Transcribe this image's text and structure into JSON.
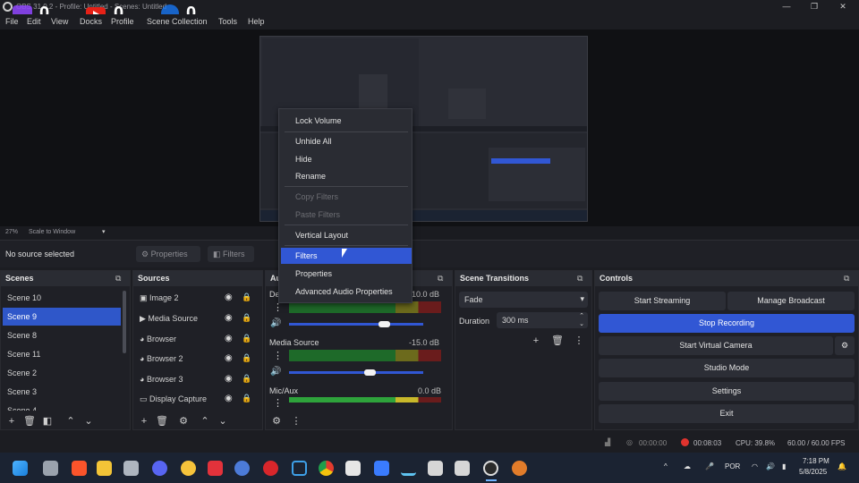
{
  "window": {
    "title": "OBS 31.0.2 - Profile: Untitled - Scenes: Untitled"
  },
  "overlay": {
    "twitch_count": "0",
    "youtube_count": "0",
    "facebook_count": "0"
  },
  "menu": [
    "File",
    "Edit",
    "View",
    "Docks",
    "Profile",
    "Scene Collection",
    "Tools",
    "Help"
  ],
  "preview": {
    "zoom": "27%",
    "scale_mode": "Scale to Window"
  },
  "source_bar": {
    "status": "No source selected",
    "properties_label": "Properties",
    "filters_label": "Filters"
  },
  "context_menu": {
    "items": [
      "Lock Volume",
      "Unhide All",
      "Hide",
      "Rename",
      "Copy Filters",
      "Paste Filters",
      "Vertical Layout",
      "Filters",
      "Properties",
      "Advanced Audio Properties"
    ],
    "highlighted": "Filters",
    "disabled": [
      "Copy Filters",
      "Paste Filters"
    ]
  },
  "scenes": {
    "title": "Scenes",
    "items": [
      "Scene 10",
      "Scene 9",
      "Scene 8",
      "Scene 11",
      "Scene 2",
      "Scene 3",
      "Scene 4"
    ],
    "selected": "Scene 9"
  },
  "sources": {
    "title": "Sources",
    "items": [
      "Image 2",
      "Media Source",
      "Browser",
      "Browser 2",
      "Browser 3",
      "Display Capture"
    ]
  },
  "mixer": {
    "title": "Audio Mixer",
    "channels": [
      {
        "name": "Desktop Audio",
        "db": "-10.0 dB",
        "level": 0.72
      },
      {
        "name": "Media Source",
        "db": "-15.0 dB",
        "level": 0.53
      },
      {
        "name": "Mic/Aux",
        "db": "0.0 dB",
        "level": 0.0
      }
    ],
    "scale": [
      "-60",
      "-55",
      "-50",
      "-45",
      "-40",
      "-35",
      "-30",
      "-25",
      "-20",
      "-15",
      "-10",
      "-5",
      "0"
    ]
  },
  "transitions": {
    "title": "Scene Transitions",
    "type": "Fade",
    "duration_label": "Duration",
    "duration": "300 ms"
  },
  "controls": {
    "title": "Controls",
    "start_streaming": "Start Streaming",
    "manage_broadcast": "Manage Broadcast",
    "stop_recording": "Stop Recording",
    "start_virtual_camera": "Start Virtual Camera",
    "studio_mode": "Studio Mode",
    "settings": "Settings",
    "exit": "Exit"
  },
  "status": {
    "stream_time": "00:00:00",
    "rec_time": "00:08:03",
    "cpu": "CPU: 39.8%",
    "fps": "60.00 / 60.00 FPS"
  },
  "taskbar": {
    "lang": "POR",
    "time": "7:18 PM",
    "date": "5/8/2025"
  },
  "colors": {
    "accent": "#3157d4",
    "youtube": "#e62117",
    "twitch": "#9146ff",
    "facebook": "#1877f2",
    "rec": "#e0332e"
  }
}
